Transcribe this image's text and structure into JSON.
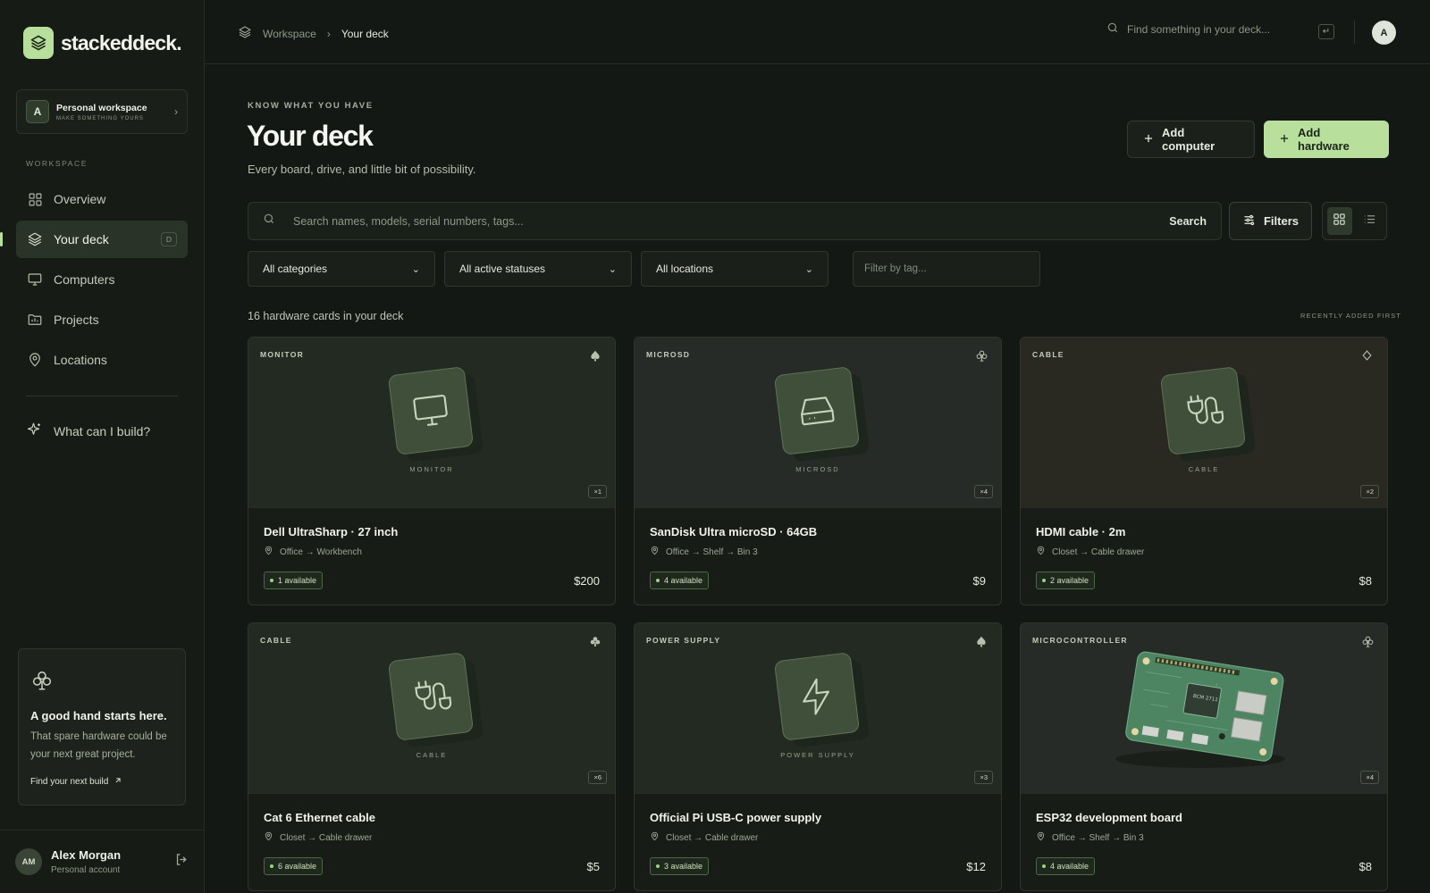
{
  "brand": {
    "name": "stackeddeck."
  },
  "workspace": {
    "name": "Personal workspace",
    "tagline": "MAKE SOMETHING YOURS",
    "initial": "A"
  },
  "sidebar": {
    "section_label": "WORKSPACE",
    "items": [
      {
        "label": "Overview",
        "icon": "grid-icon"
      },
      {
        "label": "Your deck",
        "icon": "layers-icon",
        "shortcut": "D",
        "active": true
      },
      {
        "label": "Computers",
        "icon": "monitor-icon"
      },
      {
        "label": "Projects",
        "icon": "folder-icon"
      },
      {
        "label": "Locations",
        "icon": "map-pin-icon"
      }
    ],
    "build_link": "What can I build?",
    "promo": {
      "title": "A good hand starts here.",
      "text": "That spare hardware could be your next great project.",
      "link": "Find your next build"
    },
    "user": {
      "initials": "AM",
      "name": "Alex Morgan",
      "sub": "Personal account"
    }
  },
  "topbar": {
    "crumb_root": "Workspace",
    "crumb_current": "Your deck",
    "search_placeholder": "Find something in your deck...",
    "enter_key": "↵",
    "avatar_initial": "A"
  },
  "page": {
    "eyebrow": "KNOW WHAT YOU HAVE",
    "title": "Your deck",
    "subtitle": "Every board, drive, and little bit of possibility.",
    "add_computer": "Add computer",
    "add_hardware": "Add hardware",
    "search_placeholder": "Search names, models, serial numbers, tags...",
    "search_button": "Search",
    "filters_button": "Filters",
    "category_select": "All categories",
    "status_select": "All active statuses",
    "location_select": "All locations",
    "tag_placeholder": "Filter by tag...",
    "count_text": "16 hardware cards in your deck",
    "sort_label": "RECENTLY ADDED FIRST"
  },
  "cards": [
    {
      "category": "MONITOR",
      "suit": "spade",
      "tile_label": "MONITOR",
      "qty": "×1",
      "name": "Dell UltraSharp · 27 inch",
      "location": "Office → Workbench",
      "available": "1 available",
      "price": "$200"
    },
    {
      "category": "MICROSD",
      "suit": "club",
      "tile_label": "MICROSD",
      "qty": "×4",
      "name": "SanDisk Ultra microSD · 64GB",
      "location": "Office → Shelf → Bin 3",
      "available": "4 available",
      "price": "$9"
    },
    {
      "category": "CABLE",
      "suit": "diamond",
      "tile_label": "CABLE",
      "qty": "×2",
      "name": "HDMI cable · 2m",
      "location": "Closet → Cable drawer",
      "available": "2 available",
      "price": "$8"
    },
    {
      "category": "CABLE",
      "suit": "club",
      "tile_label": "CABLE",
      "qty": "×6",
      "name": "Cat 6 Ethernet cable",
      "location": "Closet → Cable drawer",
      "available": "6 available",
      "price": "$5"
    },
    {
      "category": "POWER SUPPLY",
      "suit": "spade",
      "tile_label": "POWER SUPPLY",
      "qty": "×3",
      "name": "Official Pi USB-C power supply",
      "location": "Closet → Cable drawer",
      "available": "3 available",
      "price": "$12"
    },
    {
      "category": "MICROCONTROLLER",
      "suit": "club",
      "tile_label": "",
      "qty": "×4",
      "name": "ESP32 development board",
      "location": "Office → Shelf → Bin 3",
      "available": "4 available",
      "price": "$8",
      "chip_label": "BCM 2711"
    }
  ],
  "colors": {
    "accent": "#b9df9d",
    "background": "#141814",
    "card": "#171c16",
    "tile": "#3f4f3a",
    "board": "#4d8461"
  }
}
